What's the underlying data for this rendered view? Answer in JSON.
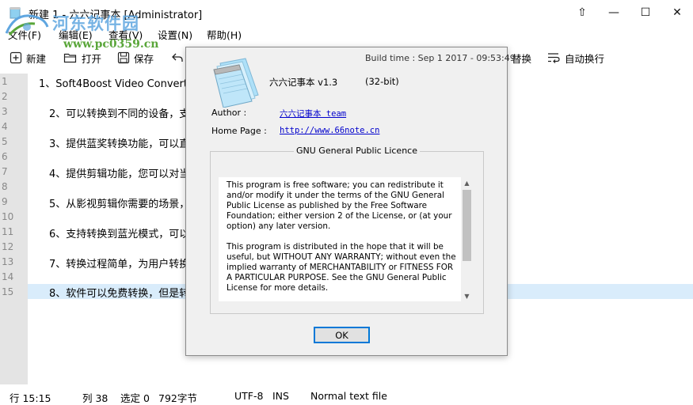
{
  "window": {
    "title": "新建 1 - 六六记事本 [Administrator]",
    "controls": [
      "⇧",
      "—",
      "☐",
      "✕"
    ]
  },
  "watermark": {
    "title": "河东软件园",
    "url": "www.pc0359.cn"
  },
  "menu": {
    "items": [
      "文件(F)",
      "编辑(E)",
      "查看(V)",
      "设置(N)",
      "帮助(H)"
    ]
  },
  "toolbar": {
    "new_label": "新建",
    "open_label": "打开",
    "save_label": "保存",
    "replace_label": "替换",
    "wrap_label": "自动换行"
  },
  "editor": {
    "line_numbers": [
      "1",
      "2",
      "3",
      "4",
      "5",
      "6",
      "7",
      "8",
      "9",
      "10",
      "11",
      "12",
      "13",
      "14",
      "15"
    ],
    "lines": [
      "1、Soft4Boost Video Converte",
      "",
      "2、可以转换到不同的设备，支",
      "",
      "3、提供蓝奖转换功能，可以直",
      "",
      "4、提供剪辑功能，您可以对当",
      "",
      "5、从影视剪辑你需要的场景，",
      "",
      "6、支持转换到蓝光模式，可以",
      "",
      "7、转换过程简单，为用户转换",
      "",
      "8、软件可以免费转换，但是转"
    ],
    "current_line": 15
  },
  "statusbar": {
    "position": "行 15:15",
    "column": "列 38",
    "selection": "选定 0",
    "chars": "792字节",
    "encoding": "UTF-8",
    "mode": "INS",
    "file_type": "Normal text file"
  },
  "about": {
    "build_time": "Build time : Sep  1 2017 - 09:53:49",
    "app_name": "六六记事本 v1.3",
    "bits": "(32-bit)",
    "author_label": "Author :",
    "author_value": "六六记事本 team",
    "homepage_label": "Home Page :",
    "homepage_value": "http://www.66note.cn",
    "licence_title": "GNU General Public Licence",
    "licence_paragraphs": [
      "This program is free software; you can redistribute it and/or modify it under the terms of the GNU General Public License as published by the Free Software Foundation; either version 2 of the License, or (at your option) any later version.",
      "This program is distributed in the hope that it will be useful, but WITHOUT ANY WARRANTY; without even the implied warranty of MERCHANTABILITY or FITNESS FOR A PARTICULAR PURPOSE.  See the GNU General Public License for more details."
    ],
    "ok_label": "OK"
  },
  "colors": {
    "current_line_bg": "#d9ecfb",
    "gutter_bg": "#e4e4e4",
    "link": "#0000cc",
    "ok_border": "#0078d7",
    "watermark_blue": "#5fa6e0",
    "watermark_green": "#5aa63a"
  }
}
